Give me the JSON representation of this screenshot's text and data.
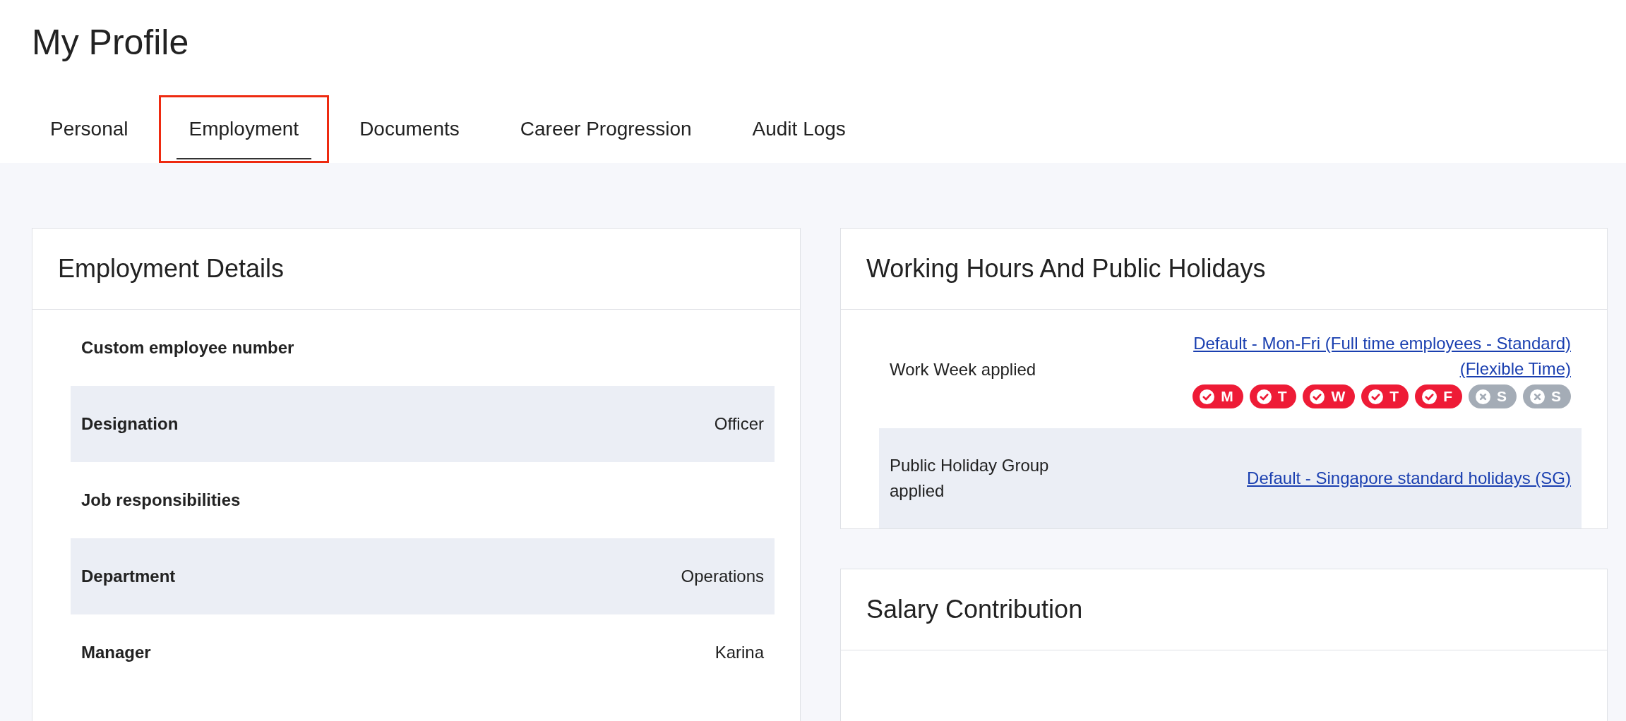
{
  "page_title": "My Profile",
  "tabs": [
    {
      "label": "Personal",
      "selected": false,
      "highlighted": false
    },
    {
      "label": "Employment",
      "selected": true,
      "highlighted": true
    },
    {
      "label": "Documents",
      "selected": false,
      "highlighted": false
    },
    {
      "label": "Career Progression",
      "selected": false,
      "highlighted": false
    },
    {
      "label": "Audit Logs",
      "selected": false,
      "highlighted": false
    }
  ],
  "employment_details": {
    "title": "Employment Details",
    "rows": [
      {
        "label": "Custom employee number"
      },
      {
        "label": "Designation",
        "value": "Officer"
      },
      {
        "label": "Job responsibilities"
      },
      {
        "label": "Department",
        "value": "Operations"
      },
      {
        "label": "Manager",
        "value": "Karina"
      }
    ]
  },
  "working_hours": {
    "title": "Working Hours And Public Holidays",
    "rows": [
      {
        "label": "Work Week applied",
        "link": "Default - Mon-Fri (Full time employees - Standard) (Flexible Time)",
        "days": [
          {
            "letter": "M",
            "on": true
          },
          {
            "letter": "T",
            "on": true
          },
          {
            "letter": "W",
            "on": true
          },
          {
            "letter": "T",
            "on": true
          },
          {
            "letter": "F",
            "on": true
          },
          {
            "letter": "S",
            "on": false
          },
          {
            "letter": "S",
            "on": false
          }
        ]
      },
      {
        "label": "Public Holiday Group applied",
        "link": "Default - Singapore standard holidays (SG)"
      }
    ]
  },
  "salary_contribution": {
    "title": "Salary Contribution"
  }
}
